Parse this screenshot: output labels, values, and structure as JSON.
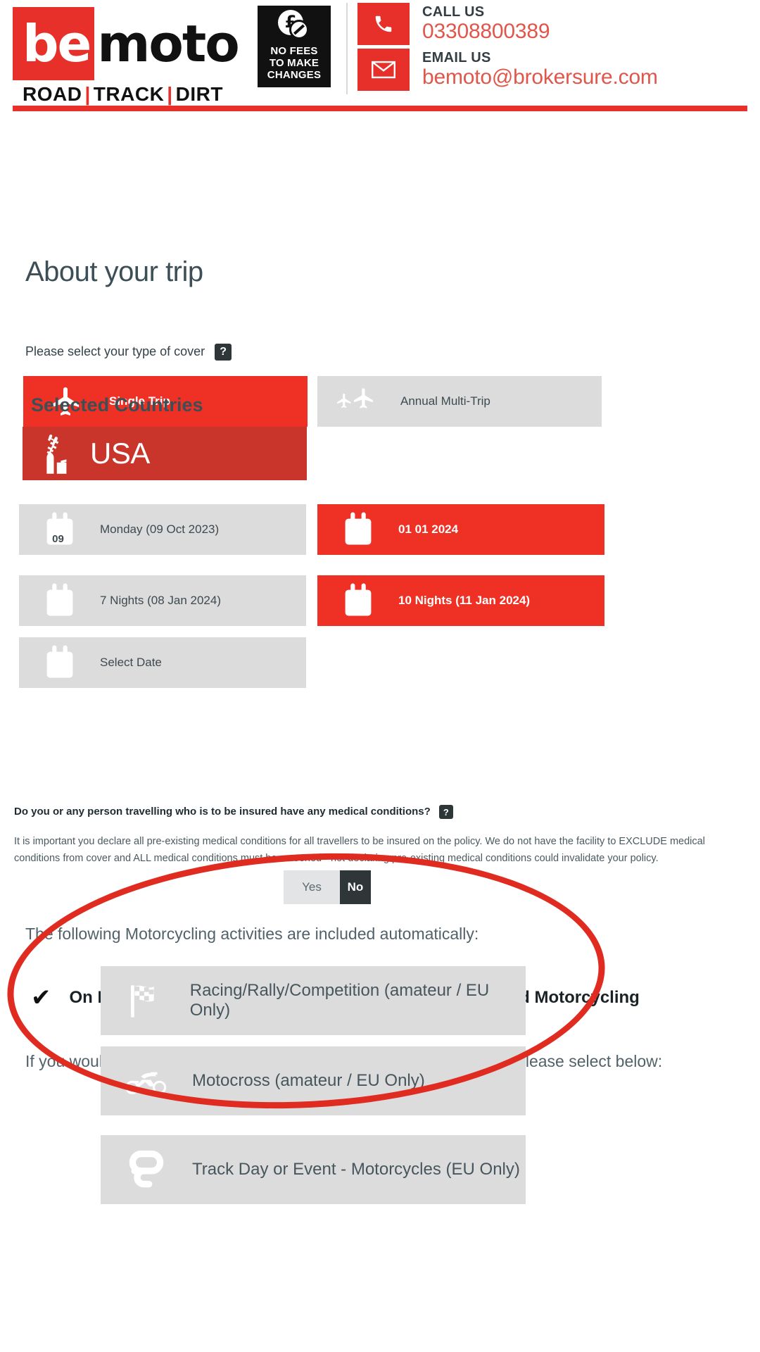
{
  "brand": {
    "logo_be": "be",
    "logo_moto": "moto",
    "tagline_road": "ROAD",
    "tagline_track": "TRACK",
    "tagline_dirt": "DIRT",
    "tagline_sep": "|",
    "accent_red": "#E8302A",
    "selected_red": "#EE3124",
    "country_red": "#C9352A",
    "grey": "#DCDCDC",
    "dark": "#2F3638"
  },
  "badge": {
    "currency_symbol": "£",
    "line1": "NO FEES",
    "line2": "TO MAKE",
    "line3": "CHANGES",
    "icon": "no-fees-coin-icon"
  },
  "contact": {
    "phone_label": "CALL US",
    "phone_value": "03308800389",
    "phone_icon": "phone-icon",
    "email_label": "EMAIL US",
    "email_value": "bemoto@brokersure.com",
    "email_icon": "envelope-icon"
  },
  "main": {
    "page_title": "About your trip",
    "cover_label": "Please select your type of cover",
    "help_glyph": "?",
    "cover_options": [
      {
        "label": "Single Trip",
        "icon": "single-plane-icon",
        "selected": true
      },
      {
        "label": "Annual Multi-Trip",
        "icon": "multi-plane-icon",
        "selected": false
      }
    ],
    "countries_heading": "Selected Countries",
    "country": {
      "label": "USA",
      "icon": "statue-of-liberty-icon"
    },
    "date_rows": [
      {
        "left": {
          "label": "Monday (09 Oct 2023)",
          "icon": "calendar-icon",
          "day": "09",
          "selected": false
        },
        "right": {
          "label": "01 01 2024",
          "icon": "calendar-icon",
          "day": "",
          "selected": true
        }
      },
      {
        "left": {
          "label": "7 Nights (08 Jan 2024)",
          "icon": "calendar-icon",
          "day": "",
          "selected": false
        },
        "right": {
          "label": "10 Nights (11 Jan 2024)",
          "icon": "calendar-icon",
          "day": "",
          "selected": true
        }
      },
      {
        "left": {
          "label": "Select Date",
          "icon": "calendar-icon",
          "day": "",
          "selected": false
        },
        "right": null
      }
    ],
    "medical_question": "Do you or any person travelling who is to be insured have any medical conditions?",
    "medical_disclaimer": "It is important you declare all pre-existing medical conditions for all travellers to be insured on the policy. We do not have the facility to EXCLUDE medical conditions from cover and ALL medical conditions must be screened - not declaring pre-existing medical conditions could invalidate your policy.",
    "medical_toggle": {
      "yes": "Yes",
      "no": "No",
      "selected": "No"
    },
    "included_heading": "The following Motorcycling activities are included automatically:",
    "included_items": [
      {
        "label": "On Road Motorcycling with appropriate UK licence",
        "tick": "✔"
      },
      {
        "label": "Off Road Motorcycling",
        "tick": "✔"
      }
    ],
    "additional_heading": "If you would like any additional Motorcycling activities to be included please select below:",
    "activities": [
      {
        "label": "Racing/Rally/Competition (amateur / EU Only)",
        "icon": "chequered-flag-icon"
      },
      {
        "label": "Motocross (amateur / EU Only)",
        "icon": "motorcycle-icon"
      },
      {
        "label": "Track Day or Event - Motorcycles (EU Only)",
        "icon": "race-track-icon"
      }
    ],
    "annotation": {
      "shape": "red-ellipse",
      "color": "#E02B20"
    }
  }
}
